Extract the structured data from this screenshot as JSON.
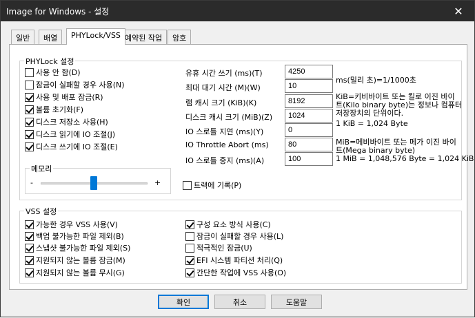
{
  "window": {
    "title": "Image for Windows - 설정",
    "close_symbol": "✕"
  },
  "tabs": [
    {
      "label": "일반"
    },
    {
      "label": "배열"
    },
    {
      "label": "PHYLock/VSS",
      "active": true
    },
    {
      "label": "예약된 작업"
    },
    {
      "label": "암호"
    }
  ],
  "phylock": {
    "title": "PHYLock 설정",
    "options": [
      {
        "label": "사용 안 함(D)",
        "checked": false
      },
      {
        "label": "잠금이 실패할 경우 사용(N)",
        "checked": false
      },
      {
        "label": "사용 및 배포 잠금(R)",
        "checked": true
      },
      {
        "label": "볼륨 초기화(F)",
        "checked": true
      },
      {
        "label": "디스크 저장소 사용(H)",
        "checked": true
      },
      {
        "label": "디스크 읽기에 IO 조절(J)",
        "checked": true
      },
      {
        "label": "디스크 쓰기에 IO 조절(E)",
        "checked": true
      }
    ],
    "memory": {
      "title": "메모리",
      "min": "-",
      "max": "+",
      "level": 0.47
    },
    "fields": [
      {
        "label": "유휴 시간 쓰기 (ms)(T)",
        "value": "4250"
      },
      {
        "label": "최대 대기 시간 (M)(W)",
        "value": "10"
      },
      {
        "label": "램 캐시 크기 (KiB)(K)",
        "value": "8192"
      },
      {
        "label": "디스크 캐시 크기 (MiB)(Z)",
        "value": "1024"
      },
      {
        "label": "IO 스로틀 지연 (ms)(Y)",
        "value": "0"
      },
      {
        "label": "IO Throttle Abort (ms)",
        "value": "80"
      },
      {
        "label": "IO 스로틀 중지 (ms)(A)",
        "value": "100"
      }
    ],
    "notes": {
      "ms": "ms(밀리 초)=1/1000초",
      "kib_line1": "KiB=키비바이트 또는 킬로 이진 바이",
      "kib_line2": "트(Kilo binary byte)는 정보나 컴퓨터",
      "kib_line3": "저장장치의 단위이다.",
      "kib_eq": "1 KiB = 1,024 Byte",
      "mib_line1": "MiB=메비바이트 또는 메가 이진 바이",
      "mib_line2": "트(Mega binary byte)",
      "mib_eq": "1 MiB = 1,048,576 Byte = 1,024 KiB"
    },
    "track_record": {
      "label": "트랙에 기록(P)",
      "checked": false
    }
  },
  "vss": {
    "title": "VSS 설정",
    "left": [
      {
        "label": "가능한 경우 VSS 사용(V)",
        "checked": true
      },
      {
        "label": "백업 불가능한 파일 제외(B)",
        "checked": true
      },
      {
        "label": "스냅샷 불가능한 파일 제외(S)",
        "checked": true
      },
      {
        "label": "지원되지 않는 볼륨 잠금(M)",
        "checked": true
      },
      {
        "label": "지원되지 않는 볼륨 무시(G)",
        "checked": true
      }
    ],
    "right": [
      {
        "label": "구성 요소 방식 사용(C)",
        "checked": true
      },
      {
        "label": "잠금이 실패할 경우 사용(L)",
        "checked": false
      },
      {
        "label": "적극적인 잠금(U)",
        "checked": false
      },
      {
        "label": "EFI 시스템 파티션 처리(Q)",
        "checked": true
      },
      {
        "label": "간단한 작업에 VSS 사용(O)",
        "checked": true
      }
    ]
  },
  "buttons": {
    "ok": "확인",
    "cancel": "취소",
    "help": "도움말"
  }
}
